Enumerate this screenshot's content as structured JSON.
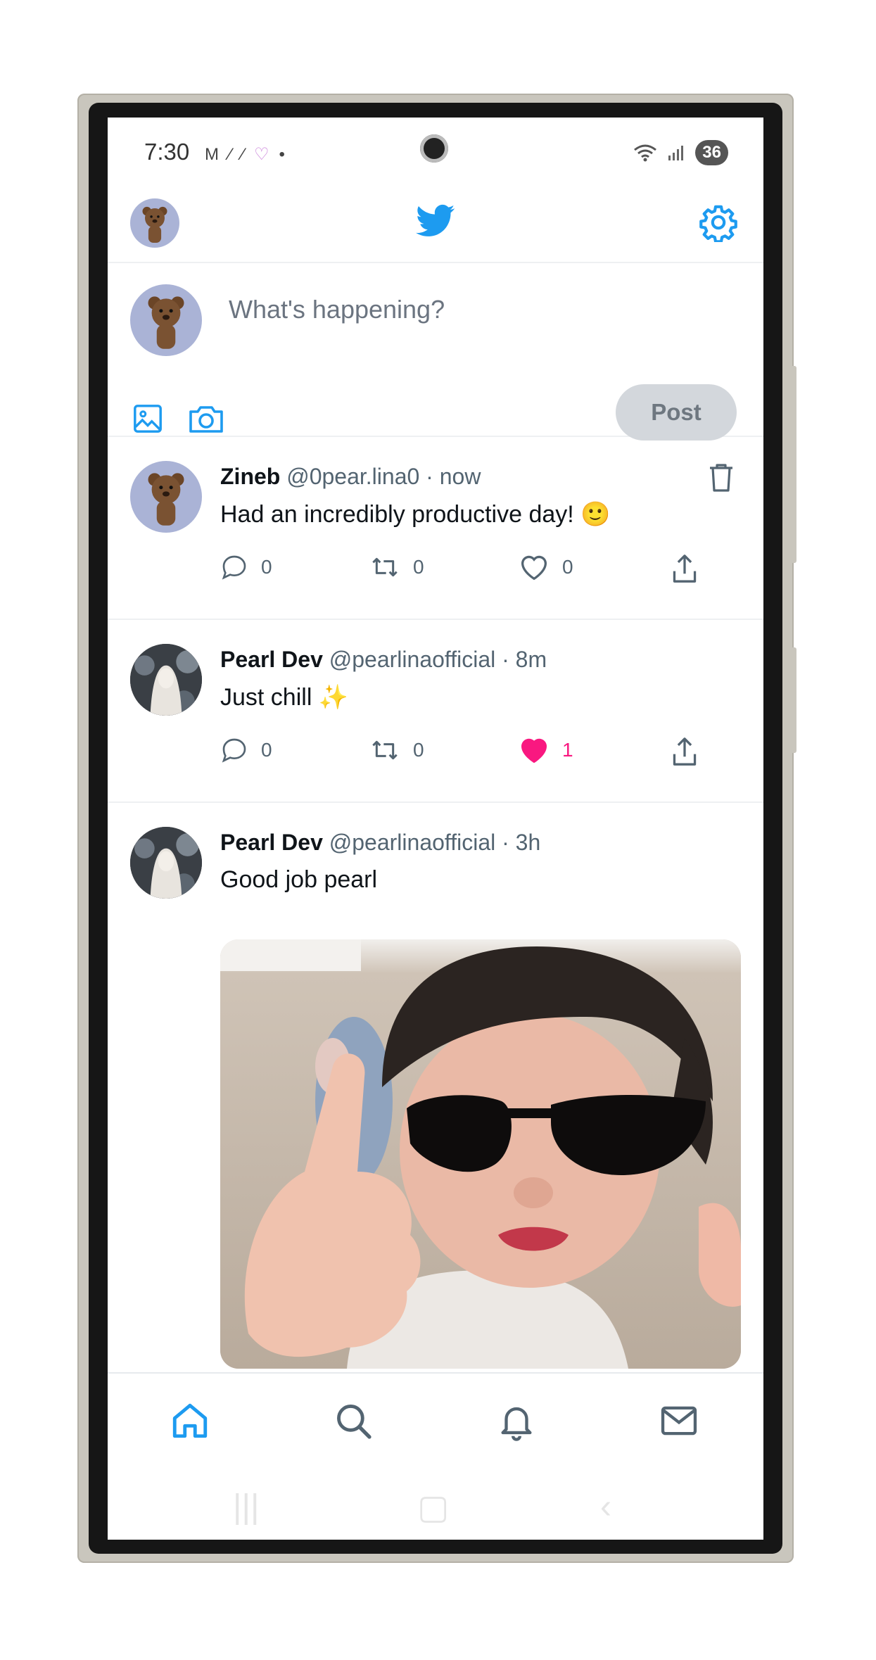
{
  "status_bar": {
    "time": "7:30",
    "left_icons": [
      "gmail-icon",
      "signal-app-icon",
      "heart-app-icon",
      "dot-icon"
    ],
    "battery": "36"
  },
  "app_bar": {
    "logo": "twitter-bird-icon",
    "settings_icon": "gear-icon"
  },
  "composer": {
    "placeholder": "What's happening?",
    "post_label": "Post"
  },
  "tweets": [
    {
      "name": "Zineb",
      "handle": "@0pear.lina0",
      "time": "· now",
      "text": "Had an incredibly productive day! 🙂",
      "replies": "0",
      "retweets": "0",
      "likes": "0",
      "liked": false
    },
    {
      "name": "Pearl Dev",
      "handle": "@pearlinaofficial",
      "time": "· 8m",
      "text": "Just chill ✨",
      "replies": "0",
      "retweets": "0",
      "likes": "1",
      "liked": true
    },
    {
      "name": "Pearl Dev",
      "handle": "@pearlinaofficial",
      "time": "· 3h",
      "text": "Good job pearl",
      "image": "baby-thumbs-up-sunglasses-photo"
    }
  ],
  "bottom_nav": [
    "home-icon",
    "search-icon",
    "bell-icon",
    "mail-icon"
  ],
  "colors": {
    "accent": "#1d9bf0",
    "like": "#f91880",
    "text": "#0f1419",
    "muted": "#536471"
  }
}
